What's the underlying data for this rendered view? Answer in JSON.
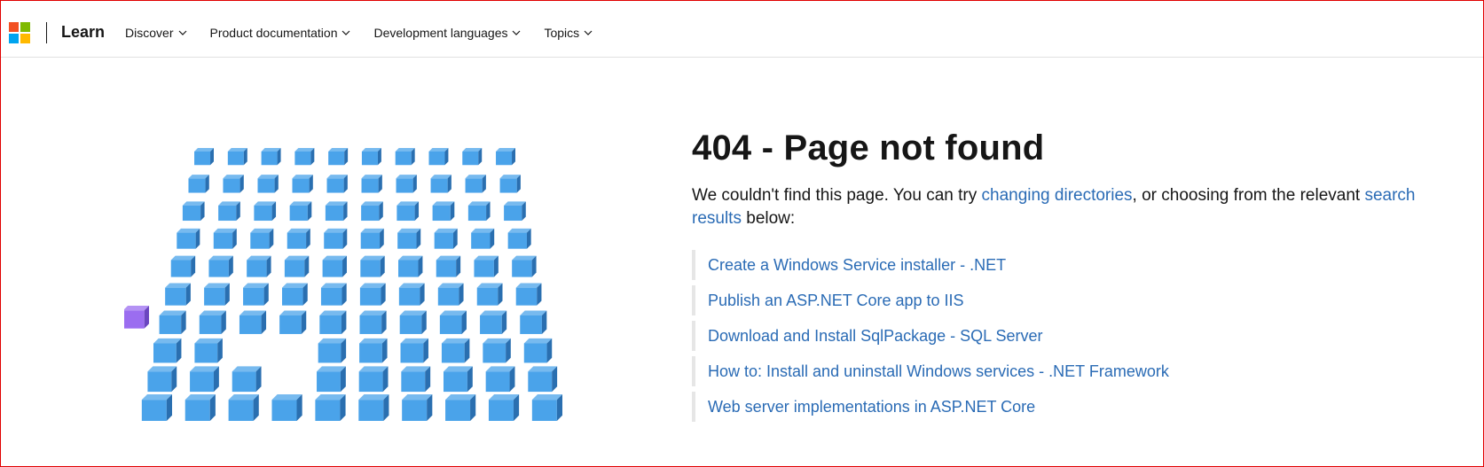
{
  "header": {
    "brand": "Learn",
    "logo_colors": [
      "#f25022",
      "#7fba00",
      "#00a4ef",
      "#ffb900"
    ],
    "nav": [
      {
        "label": "Discover",
        "icon": "chevron-down-icon"
      },
      {
        "label": "Product documentation",
        "icon": "chevron-down-icon"
      },
      {
        "label": "Development languages",
        "icon": "chevron-down-icon"
      },
      {
        "label": "Topics",
        "icon": "chevron-down-icon"
      }
    ]
  },
  "main": {
    "title": "404 - Page not found",
    "description": {
      "part1": "We couldn't find this page. You can try ",
      "link1": "changing directories",
      "part2": ", or choosing from the relevant ",
      "link2": "search results",
      "part3": " below:"
    },
    "results": [
      "Create a Windows Service installer - .NET",
      "Publish an ASP.NET Core app to IIS",
      "Download and Install SqlPackage - SQL Server",
      "How to: Install and uninstall Windows services - .NET Framework",
      "Web server implementations in ASP.NET Core"
    ],
    "illustration": {
      "name": "cube-grid-illustration",
      "cube_color": "#4aa3ea",
      "cube_dark": "#2a6fb0",
      "accent_cube_color": "#9b6df0"
    }
  },
  "colors": {
    "link": "#2a6bb5",
    "text": "#161616",
    "frame": "#e00000"
  }
}
